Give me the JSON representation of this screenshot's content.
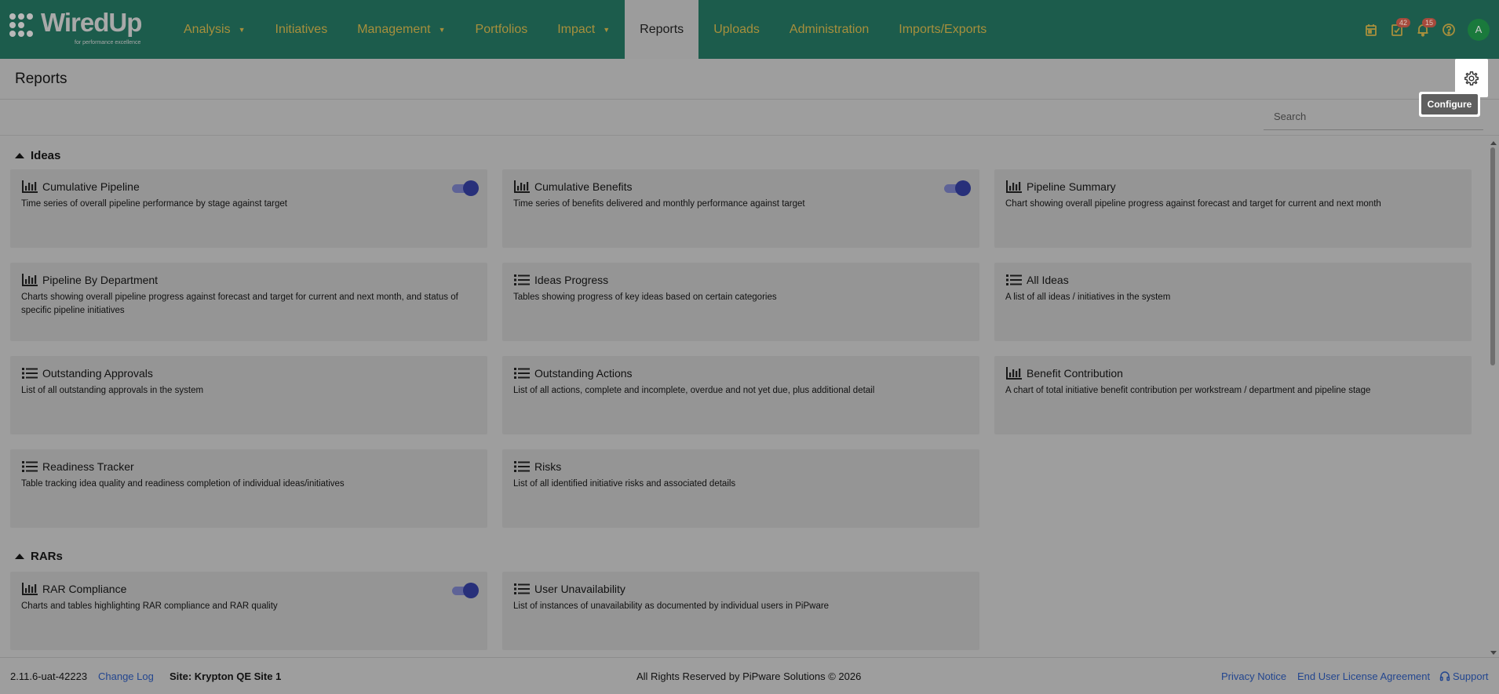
{
  "logo": {
    "name": "WiredUp",
    "tagline": "for performance excellence"
  },
  "nav": {
    "items": [
      {
        "label": "Analysis",
        "dropdown": true
      },
      {
        "label": "Initiatives",
        "dropdown": false
      },
      {
        "label": "Management",
        "dropdown": true
      },
      {
        "label": "Portfolios",
        "dropdown": false
      },
      {
        "label": "Impact",
        "dropdown": true
      },
      {
        "label": "Reports",
        "dropdown": false,
        "active": true
      },
      {
        "label": "Uploads",
        "dropdown": false
      },
      {
        "label": "Administration",
        "dropdown": false
      },
      {
        "label": "Imports/Exports",
        "dropdown": false
      }
    ],
    "icons": [
      {
        "name": "calendar-icon",
        "badge": ""
      },
      {
        "name": "tasks-icon",
        "badge": "42"
      },
      {
        "name": "bell-icon",
        "badge": "15"
      },
      {
        "name": "help-icon",
        "badge": ""
      }
    ],
    "avatar": "A"
  },
  "page": {
    "title": "Reports",
    "configure_tooltip": "Configure",
    "search_placeholder": "Search"
  },
  "sections": [
    {
      "title": "Ideas",
      "cards": [
        {
          "title": "Cumulative Pipeline",
          "desc": "Time series of overall pipeline performance by stage against target",
          "icon": "bar-chart-icon",
          "toggle": true
        },
        {
          "title": "Cumulative Benefits",
          "desc": "Time series of benefits delivered and monthly performance against target",
          "icon": "bar-chart-icon",
          "toggle": true
        },
        {
          "title": "Pipeline Summary",
          "desc": "Chart showing overall pipeline progress against forecast and target for current and next month",
          "icon": "bar-chart-icon",
          "toggle": false
        },
        {
          "title": "Pipeline By Department",
          "desc": "Charts showing overall pipeline progress against forecast and target for current and next month, and status of specific pipeline initiatives",
          "icon": "bar-chart-icon",
          "toggle": false
        },
        {
          "title": "Ideas Progress",
          "desc": "Tables showing progress of key ideas based on certain categories",
          "icon": "list-icon",
          "toggle": false
        },
        {
          "title": "All Ideas",
          "desc": "A list of all ideas / initiatives in the system",
          "icon": "list-icon",
          "toggle": false
        },
        {
          "title": "Outstanding Approvals",
          "desc": "List of all outstanding approvals in the system",
          "icon": "list-icon",
          "toggle": false
        },
        {
          "title": "Outstanding Actions",
          "desc": "List of all actions, complete and incomplete, overdue and not yet due, plus additional detail",
          "icon": "list-icon",
          "toggle": false
        },
        {
          "title": "Benefit Contribution",
          "desc": "A chart of total initiative benefit contribution per workstream / department and pipeline stage",
          "icon": "bar-chart-icon",
          "toggle": false
        },
        {
          "title": "Readiness Tracker",
          "desc": "Table tracking idea quality and readiness completion of individual ideas/initiatives",
          "icon": "list-icon",
          "toggle": false
        },
        {
          "title": "Risks",
          "desc": "List of all identified initiative risks and associated details",
          "icon": "list-icon",
          "toggle": false
        }
      ]
    },
    {
      "title": "RARs",
      "cards": [
        {
          "title": "RAR Compliance",
          "desc": "Charts and tables highlighting RAR compliance and RAR quality",
          "icon": "bar-chart-icon",
          "toggle": true
        },
        {
          "title": "User Unavailability",
          "desc": "List of instances of unavailability as documented by individual users in PiPware",
          "icon": "list-icon",
          "toggle": false
        }
      ]
    }
  ],
  "footer": {
    "version": "2.11.6-uat-42223",
    "change_log": "Change Log",
    "site": "Site: Krypton QE Site 1",
    "rights": "All Rights Reserved by PiPware Solutions © 2026",
    "privacy": "Privacy Notice",
    "eula": "End User License Agreement",
    "support": "Support"
  }
}
